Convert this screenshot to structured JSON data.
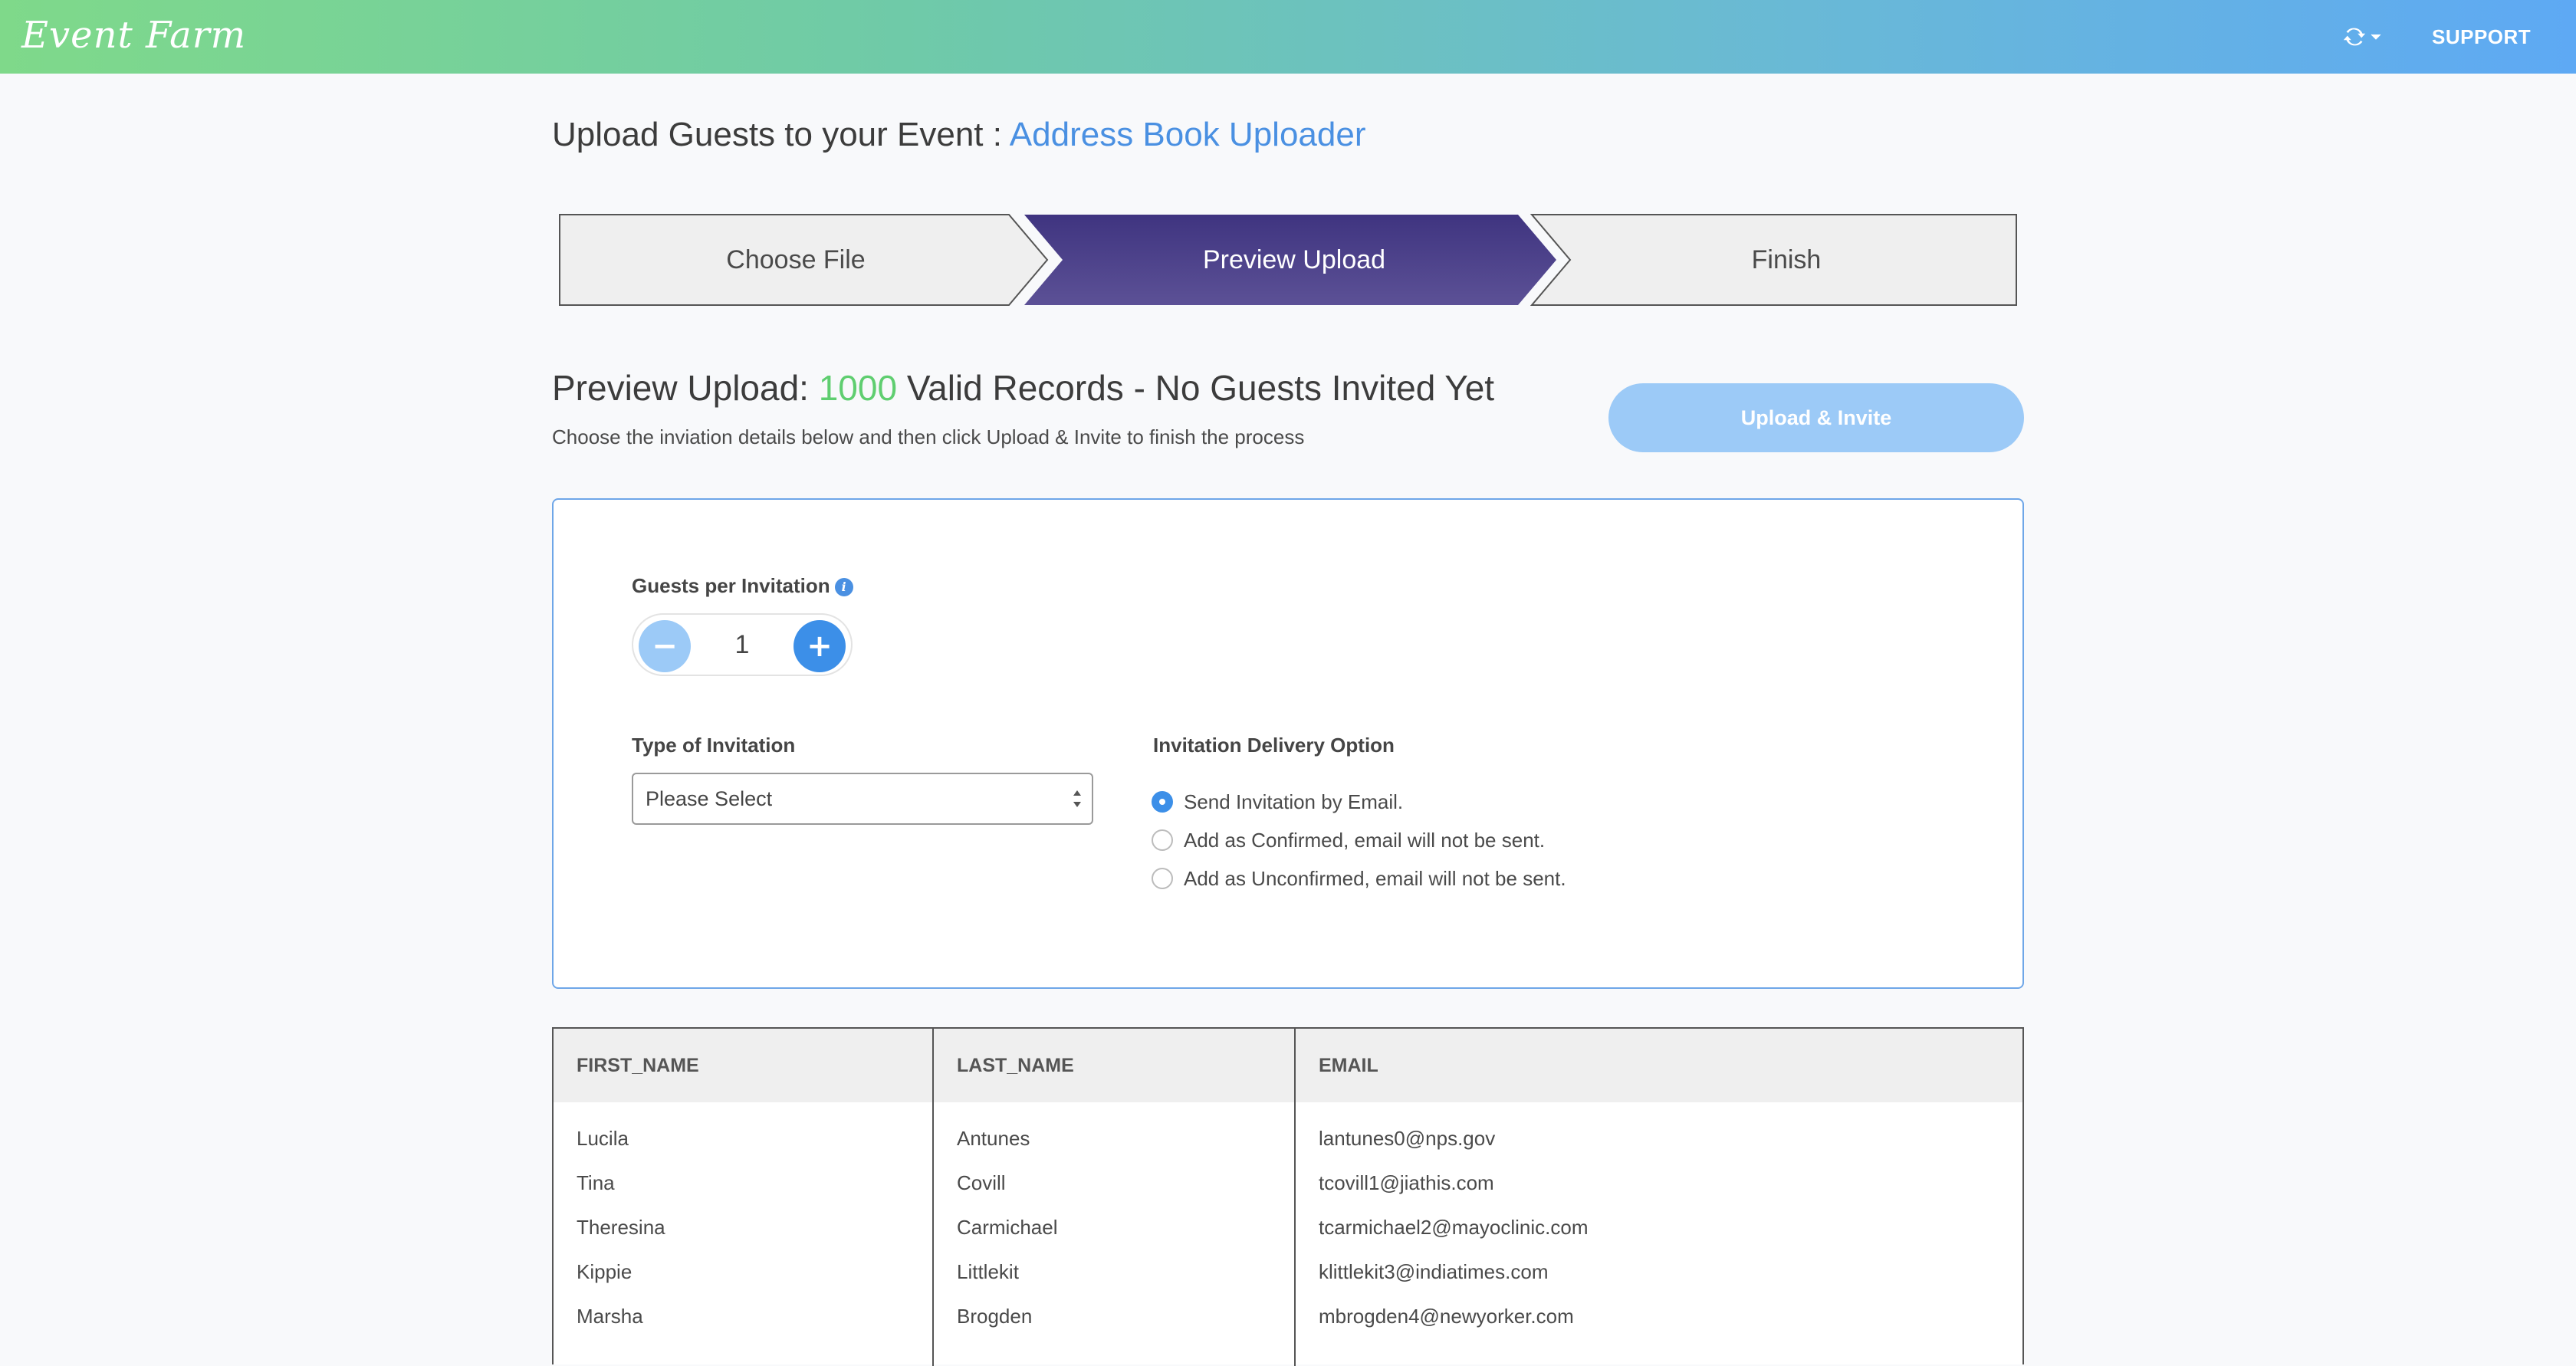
{
  "app": {
    "logo_text": "Event Farm",
    "support_label": "SUPPORT",
    "sync_icon": "sync-icon"
  },
  "page": {
    "title_prefix": "Upload Guests to your Event : ",
    "title_accent": "Address Book Uploader"
  },
  "steps": [
    {
      "label": "Choose File",
      "active": false
    },
    {
      "label": "Preview Upload",
      "active": true
    },
    {
      "label": "Finish",
      "active": false
    }
  ],
  "preview": {
    "heading_prefix": "Preview Upload: ",
    "valid_count": "1000",
    "heading_suffix": " Valid Records - No Guests Invited Yet",
    "subtext": "Choose the inviation details below and then click Upload & Invite to finish the process",
    "upload_button": "Upload & Invite"
  },
  "options": {
    "guests_label": "Guests per Invitation",
    "guests_value": "1",
    "minus_symbol": "−",
    "plus_symbol": "+",
    "invitation_type_label": "Type of Invitation",
    "invitation_type_value": "Please Select",
    "delivery_label": "Invitation Delivery Option",
    "delivery_options": [
      {
        "label": "Send Invitation by Email.",
        "checked": true
      },
      {
        "label": "Add as Confirmed, email will not be sent.",
        "checked": false
      },
      {
        "label": "Add as Unconfirmed, email will not be sent.",
        "checked": false
      }
    ]
  },
  "table": {
    "columns": [
      "FIRST_NAME",
      "LAST_NAME",
      "EMAIL"
    ],
    "rows": [
      [
        "Lucila",
        "Antunes",
        "lantunes0@nps.gov"
      ],
      [
        "Tina",
        "Covill",
        "tcovill1@jiathis.com"
      ],
      [
        "Theresina",
        "Carmichael",
        "tcarmichael2@mayoclinic.com"
      ],
      [
        "Kippie",
        "Littlekit",
        "klittlekit3@indiatimes.com"
      ],
      [
        "Marsha",
        "Brogden",
        "mbrogden4@newyorker.com"
      ]
    ]
  },
  "colors": {
    "accent": "#4a90e2",
    "active_step": "#4b3f87",
    "valid_count": "#5fce70",
    "upload_button": "#9ccaf7"
  }
}
